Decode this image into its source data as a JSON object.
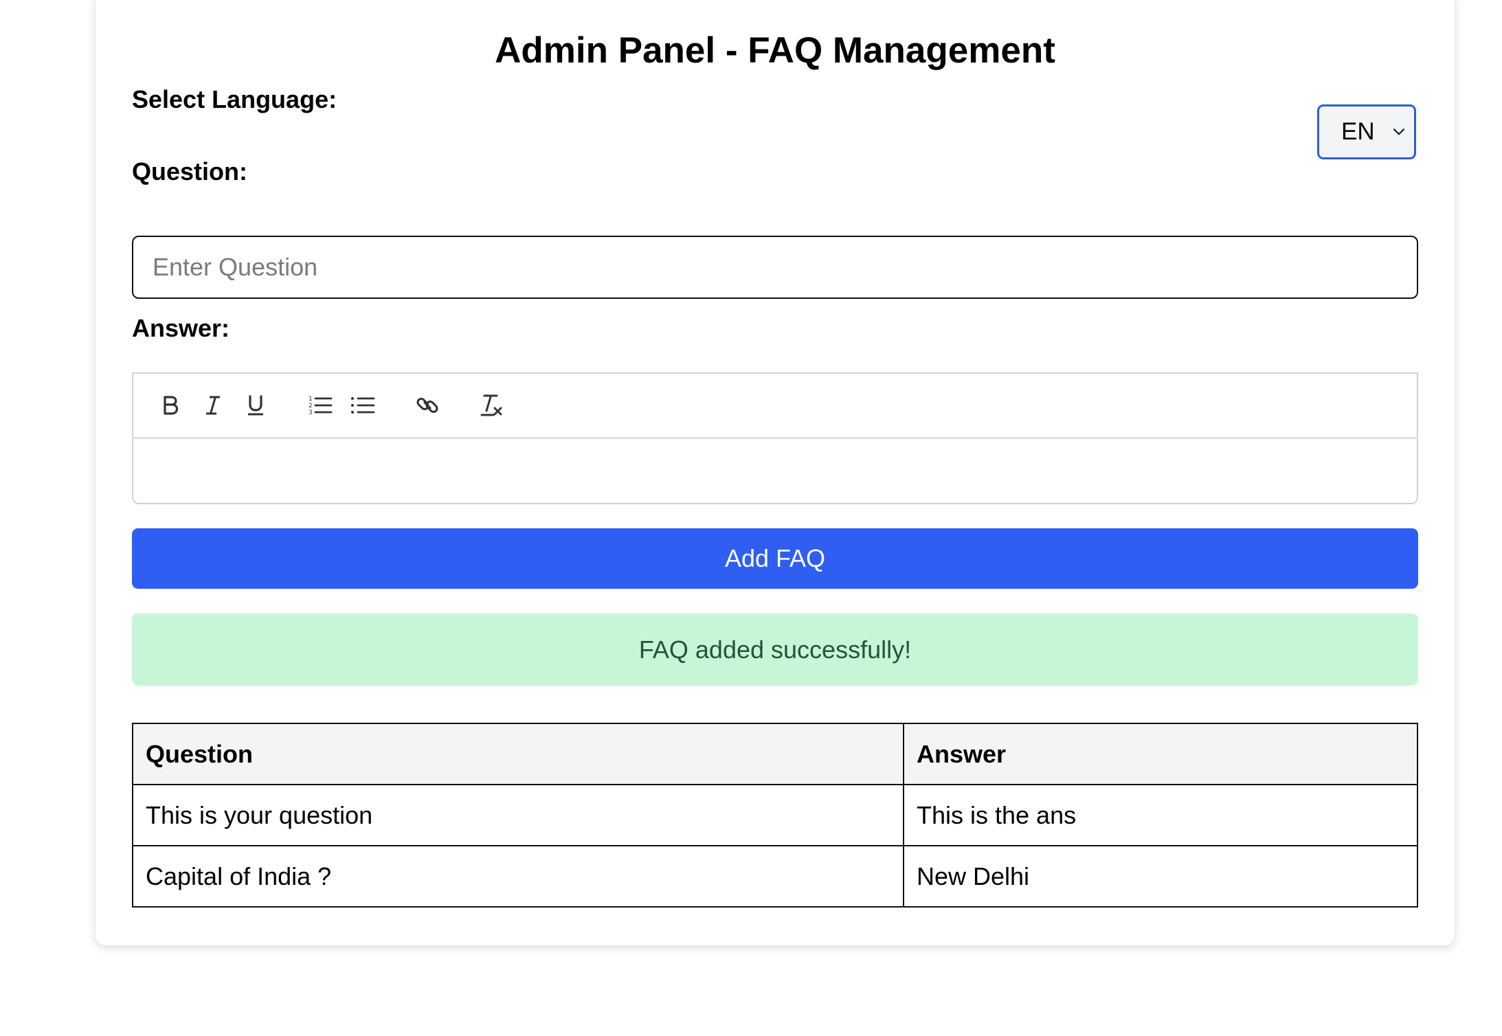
{
  "page": {
    "title": "Admin Panel - FAQ Management"
  },
  "language": {
    "label": "Select Language:",
    "selected": "EN"
  },
  "question": {
    "label": "Question:",
    "placeholder": "Enter Question",
    "value": ""
  },
  "answer": {
    "label": "Answer:",
    "toolbar": [
      {
        "name": "bold-button",
        "icon": "bold-icon"
      },
      {
        "name": "italic-button",
        "icon": "italic-icon"
      },
      {
        "name": "underline-button",
        "icon": "underline-icon"
      },
      {
        "name": "ordered-list-button",
        "icon": "ordered-list-icon"
      },
      {
        "name": "bullet-list-button",
        "icon": "bullet-list-icon"
      },
      {
        "name": "link-button",
        "icon": "link-icon"
      },
      {
        "name": "clear-format-button",
        "icon": "clear-format-icon"
      }
    ],
    "value": ""
  },
  "actions": {
    "add_label": "Add FAQ"
  },
  "alert": {
    "message": "FAQ added successfully!"
  },
  "colors": {
    "primary": "#2e5ef2",
    "select_border": "#2b5fd6",
    "success_bg": "#c6f6d5",
    "success_text": "#22543d",
    "header_bg": "#f3f4f6"
  },
  "table": {
    "headers": [
      "Question",
      "Answer"
    ],
    "rows": [
      {
        "question": "This is your question",
        "answer": "This is the ans"
      },
      {
        "question": "Capital of India ?",
        "answer": "New Delhi"
      }
    ]
  }
}
